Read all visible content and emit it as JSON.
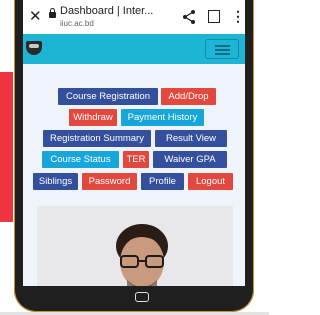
{
  "browser": {
    "title": "Dashboard | Inter...",
    "url": "iiuc.ac.bd"
  },
  "buttons": {
    "course_registration": "Course Registration",
    "add_drop": "Add/Drop",
    "withdraw": "Withdraw",
    "payment_history": "Payment History",
    "registration_summary": "Registration Summary",
    "result_view": "Result View",
    "course_status": "Course Status",
    "ter": "TER",
    "waiver_gpa": "Waiver GPA",
    "siblings": "Siblings",
    "password": "Password",
    "profile": "Profile",
    "logout": "Logout"
  },
  "colors": {
    "navy": "#34509d",
    "red": "#e2483e",
    "cyan": "#17a6d9",
    "navbar": "#1cb5d4"
  },
  "icons": [
    "close-icon",
    "lock-icon",
    "share-icon",
    "bookmark-icon",
    "more-vert-icon",
    "hamburger-icon",
    "home-icon"
  ]
}
